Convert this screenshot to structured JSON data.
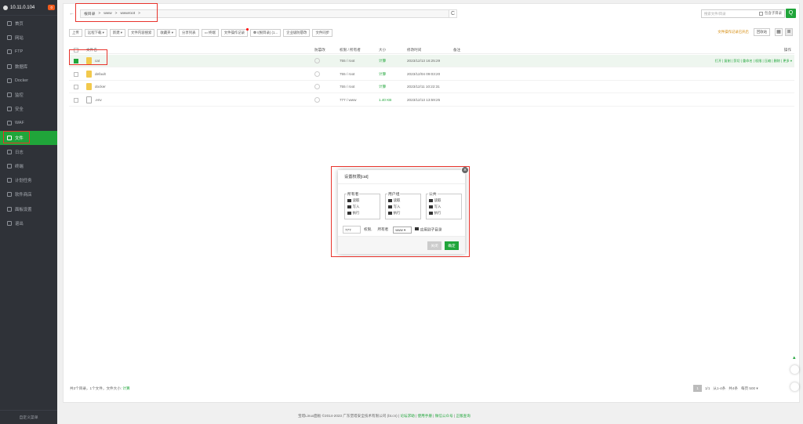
{
  "sidebar": {
    "ip": "10.11.0.104",
    "badge": "0",
    "items": [
      {
        "label": "首页",
        "active": false
      },
      {
        "label": "网站",
        "active": false
      },
      {
        "label": "FTP",
        "active": false
      },
      {
        "label": "数据库",
        "active": false
      },
      {
        "label": "Docker",
        "active": false
      },
      {
        "label": "监控",
        "active": false
      },
      {
        "label": "安全",
        "active": false
      },
      {
        "label": "WAF",
        "active": false
      },
      {
        "label": "文件",
        "active": true
      },
      {
        "label": "日志",
        "active": false
      },
      {
        "label": "终端",
        "active": false
      },
      {
        "label": "计划任务",
        "active": false
      },
      {
        "label": "软件商店",
        "active": false
      },
      {
        "label": "面板设置",
        "active": false
      },
      {
        "label": "退出",
        "active": false
      }
    ],
    "footer": "自定义菜单"
  },
  "address": {
    "back": "←",
    "crumbs": [
      "根目录",
      ">",
      "www",
      ">",
      "wwwroot",
      ">"
    ],
    "refresh": "C",
    "search_placeholder": "搜索文件/目录",
    "subdir_label": "包含子目录",
    "search_btn": "Q"
  },
  "toolbar": {
    "buttons": [
      "上传",
      "远程下载 ▾",
      "新建 ▾",
      "文件内容搜索",
      "收藏夹 ▾",
      "分享列表",
      "▭ 终端",
      "文件操作记录",
      "⛃ /(根目录) (1...",
      "企业级防篡改",
      "文件同步"
    ],
    "warning": "文件操作记录已开启",
    "recycle": "回收站"
  },
  "table": {
    "headers": {
      "name": "文件名",
      "protect": "防篡改",
      "perm": "权限 / 所有者",
      "size": "大小",
      "mtime": "修改时间",
      "remark": "备注",
      "ops": "操作"
    },
    "rows": [
      {
        "name": "cat",
        "type": "folder",
        "perm": "755 / root",
        "size": "计算",
        "mtime": "2023/12/13 16:25:29",
        "selected": true
      },
      {
        "name": "default",
        "type": "folder",
        "perm": "755 / root",
        "size": "计算",
        "mtime": "2023/12/04 09:03:20",
        "selected": false
      },
      {
        "name": "docker",
        "type": "folder",
        "perm": "755 / root",
        "size": "计算",
        "mtime": "2023/12/11 10:22:31",
        "selected": false
      },
      {
        "name": ".env",
        "type": "file",
        "perm": "777 / www",
        "size": "1.40 KB",
        "mtime": "2023/12/13 13:59:25",
        "selected": false
      }
    ],
    "row_ops": "打开 | 复制 | 剪切 | 重命名 | 权限 | 压缩 | 删除 | 更多 ▾"
  },
  "footer": {
    "info": "共3个目录，1个文件，文件大小:",
    "info_link": "计算",
    "pager": {
      "page_btn": "1",
      "pages": "1/1",
      "range": "从1-4条",
      "total": "共4条",
      "per_page": "每页 500 ▾"
    },
    "copyright": "宝塔Linux面板 ©2014-2023 广东堡塔安全技术有限公司 (bt.cn)",
    "links": [
      "论坛求助",
      "使用手册",
      "微信公众号",
      "正版查询"
    ]
  },
  "dialog": {
    "title": "设置权限[cat]",
    "groups": [
      {
        "legend": "所有者",
        "items": [
          "读取",
          "写入",
          "执行"
        ]
      },
      {
        "legend": "用户组",
        "items": [
          "读取",
          "写入",
          "执行"
        ]
      },
      {
        "legend": "公共",
        "items": [
          "读取",
          "写入",
          "执行"
        ]
      }
    ],
    "mode_value": "777",
    "perm_label": "权限,",
    "owner_label": "所有者",
    "owner_value": "www ▾",
    "apply_label": "应用到子目录",
    "cancel": "关闭",
    "confirm": "确定",
    "close": "×"
  },
  "colors": {
    "accent": "#20a53a",
    "sidebar": "#2f3238",
    "highlight": "#e8332c"
  }
}
